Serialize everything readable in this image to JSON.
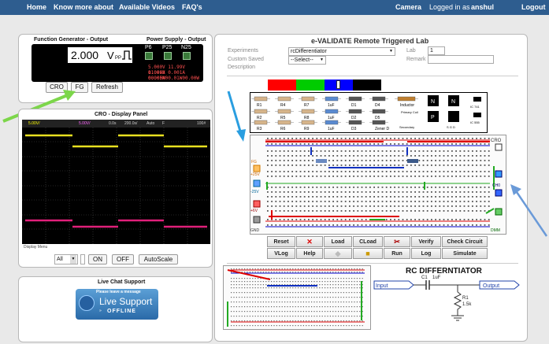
{
  "nav": {
    "home": "Home",
    "know_more": "Know more about",
    "videos": "Available Videos",
    "faqs": "FAQ's",
    "camera": "Camera",
    "logged_in_prefix": "Logged in as",
    "username": "anshul",
    "logout": "Logout"
  },
  "function_generator": {
    "title_left": "Function Generator - Output",
    "title_right": "Power Supply - Output",
    "display_value": "2.000",
    "display_unit": "V",
    "display_unit_sub": "PP",
    "channels": [
      "P6",
      "P25",
      "N25"
    ],
    "readout_line1": "5.000V  11.99V  11.99V",
    "readout_line2": "0.006A 0.001A 0.000A",
    "readout_line3": "00.05W00.01W00.00W",
    "buttons": {
      "cro": "CRO",
      "fg": "FG",
      "refresh": "Refresh"
    }
  },
  "cro": {
    "title": "CRO - Display Panel",
    "header_ch1": "5.00V/",
    "header_ch2": "5.00V/",
    "header_offset": "0.0s",
    "header_timebase": "200.0s/",
    "header_mode": "Auto",
    "header_trig": "F",
    "header_level": "100#",
    "display_menu": "Display Menu",
    "select_value": "All",
    "buttons": {
      "on": "ON",
      "off": "OFF",
      "autoscale": "AutoScale"
    }
  },
  "chat": {
    "title": "Live Chat Support",
    "leave_message": "Please leave a message",
    "brand": "Live Support",
    "status": "OFFLINE"
  },
  "lab": {
    "title": "e-VALIDATE Remote Triggered Lab",
    "experiments_label": "Experiments",
    "experiments_value": "rcDifferentiator",
    "lab_label": "Lab",
    "lab_value": "1",
    "custom_saved_label": "Custom Saved",
    "description_label": "Description",
    "select_placeholder": "--Select--",
    "remark_label": "Remark"
  },
  "palette_colors": [
    "#ff0000",
    "#00cc00",
    "#0000ff",
    "#000000"
  ],
  "components": {
    "row1": [
      "R1",
      "R4",
      "R7",
      "1uF",
      "D1",
      "D4",
      "Inductor"
    ],
    "row2": [
      "R2",
      "R5",
      "R8",
      "1uF",
      "D2",
      "D5"
    ],
    "row3": [
      "R3",
      "R6",
      "R9",
      "1uF",
      "D3",
      "Zener D"
    ],
    "primary_coil": "Primary Coil",
    "secondary": "Secondary",
    "ic_labels": [
      "IC 741",
      "IC 555"
    ],
    "transistor_labels": [
      "N",
      "P",
      "N",
      "S G D"
    ]
  },
  "breadboard": {
    "cro_label": "CRO",
    "ch0_label": "CH0",
    "gnd_left": "GND",
    "gnd_right": "DMM",
    "plus25": "+25V",
    "minus25": "-25V",
    "plus6": "+6V",
    "fg_label": "FG"
  },
  "toolbar": {
    "row1": [
      "Reset",
      "",
      "Load",
      "CLoad",
      "",
      "Verify",
      "Check Circuit"
    ],
    "row2": [
      "VLog",
      "Help",
      "",
      "",
      "Run",
      "Log",
      "Simulate"
    ]
  },
  "schematic": {
    "title": "RC DIFFERNTIATOR",
    "input": "Input",
    "output": "Output",
    "c_label": "C1",
    "c_value": "1uF",
    "r_label": "R1",
    "r_value": "1.5k"
  }
}
